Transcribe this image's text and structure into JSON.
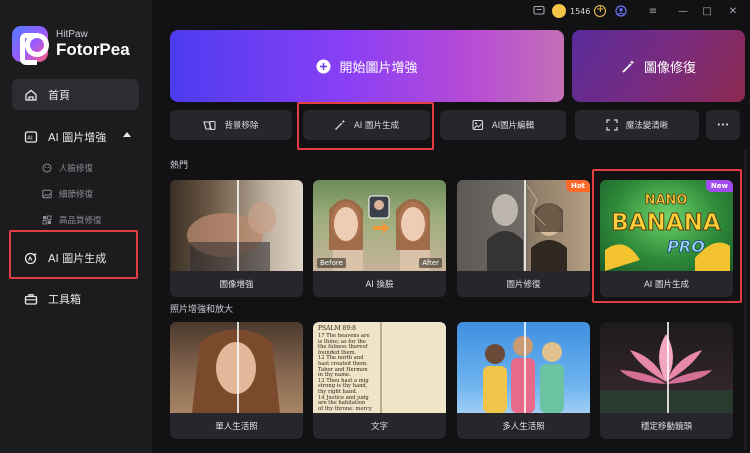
{
  "app": {
    "brand_sub": "HitPaw",
    "brand_main": "FotorPea"
  },
  "topbar": {
    "credits": "1546",
    "plus": "+",
    "minimize": "—",
    "maximize": "□",
    "close": "✕",
    "menu": "≡"
  },
  "sidebar": {
    "home": "首頁",
    "enhance": "AI 圖片增強",
    "sub_items": [
      "人臉修復",
      "細節修復",
      "高品質修復"
    ],
    "ai_generate": "AI 圖片生成",
    "toolbox": "工具箱"
  },
  "main": {
    "enhance_button": "開始圖片增強",
    "repair_button": "圖像修復",
    "tools": [
      "背景移除",
      "AI 圖片生成",
      "AI圖片編輯",
      "魔法變清晰"
    ],
    "more": "•••",
    "hot_title": "熱門",
    "hot_cards": [
      {
        "label": "圖像增強"
      },
      {
        "label": "AI 換臉",
        "before": "Before",
        "after": "After"
      },
      {
        "label": "圖片修復",
        "badge": "Hot"
      },
      {
        "label": "AI 圖片生成",
        "badge": "New",
        "art_top": "NANO",
        "art_mid": "BANANA",
        "art_bot": "PRO"
      }
    ],
    "photo_title": "照片增強和放大",
    "photo_cards": [
      {
        "label": "單人生活照"
      },
      {
        "label": "文字",
        "doc_title": "PSALM 89:8",
        "doc_lines": [
          "17 The heavens are",
          "is thine; as for the",
          "the fulness thereof",
          "founded them.",
          "12 The north and",
          "hast created them:",
          "Tabor and Hermon",
          "in thy name.",
          "13 Thou hast a mig",
          "strong is thy hand,",
          "thy right hand.",
          "14 Justice and judg",
          "are the habitation",
          "of thy throne: mercy"
        ]
      },
      {
        "label": "多人生活照"
      },
      {
        "label": "穩定移動鏡頭"
      }
    ]
  },
  "colors": {
    "accent_red": "#e43e44",
    "hot_badge": "#ff6a2a",
    "new_badge": "#a24cf0",
    "coin": "#f5c54a"
  }
}
